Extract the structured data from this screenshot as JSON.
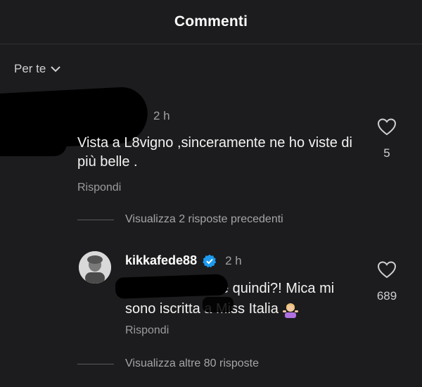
{
  "header": {
    "title": "Commenti"
  },
  "filter": {
    "label": "Per te"
  },
  "comments": [
    {
      "time": "2 h",
      "text": "Vista a L8vigno ,sinceramente ne ho viste di più  belle .",
      "reply_label": "Rispondi",
      "likes": "5"
    }
  ],
  "view_prev": {
    "label": "Visualizza 2 risposte precedenti"
  },
  "reply": {
    "username": "kikkafede88",
    "time": "2 h",
    "text_line1": "e quindi?! Mica mi",
    "text_line2": "sono iscritta a Miss Italia",
    "reply_label": "Rispondi",
    "likes": "689"
  },
  "view_more": {
    "label": "Visualizza altre 80 risposte"
  },
  "colors": {
    "background": "#1c1c1e",
    "verified": "#1d9bf0",
    "muted_text": "#a0a0a3"
  },
  "icons": {
    "heart": "heart-outline-icon",
    "verified": "verified-badge-icon",
    "chevron": "chevron-down-icon",
    "emoji": "woman-shrugging-emoji"
  }
}
